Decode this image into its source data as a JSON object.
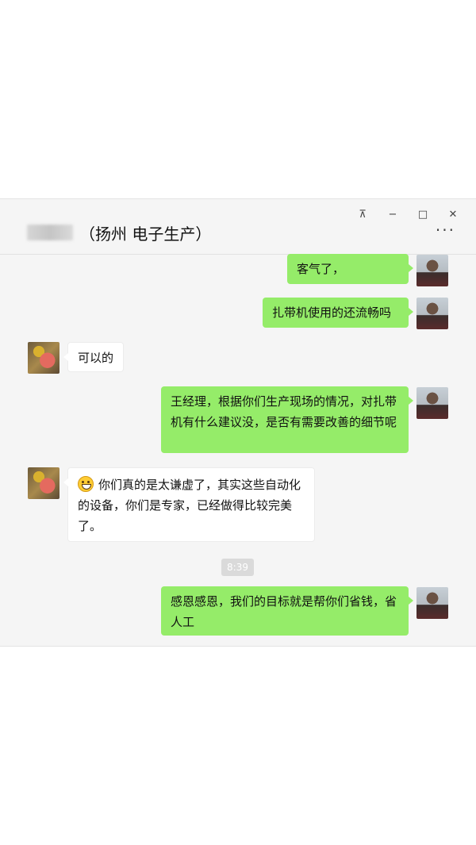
{
  "window": {
    "title": "（扬州 电子生产）",
    "controls": {
      "pin": "⊼",
      "minimize": "−",
      "maximize": "□",
      "close": "✕"
    },
    "more": "···"
  },
  "messages": [
    {
      "from": "me",
      "text": "客气了，"
    },
    {
      "from": "me",
      "text": "扎带机使用的还流畅吗"
    },
    {
      "from": "other",
      "text": "可以的"
    },
    {
      "from": "me",
      "text": "王经理，根据你们生产现场的情况，对扎带机有什么建议没，是否有需要改善的细节呢"
    },
    {
      "from": "other",
      "emoji": "smile-emoji",
      "text": "你们真的是太谦虚了，其实这些自动化的设备，你们是专家，已经做得比较完美了。"
    },
    {
      "from": "me",
      "text": "感恩感恩，我们的目标就是帮你们省钱，省人工"
    }
  ],
  "timestamp": "8:39",
  "colors": {
    "my_bubble": "#95ec69",
    "other_bubble": "#ffffff",
    "background": "#f5f5f5"
  }
}
